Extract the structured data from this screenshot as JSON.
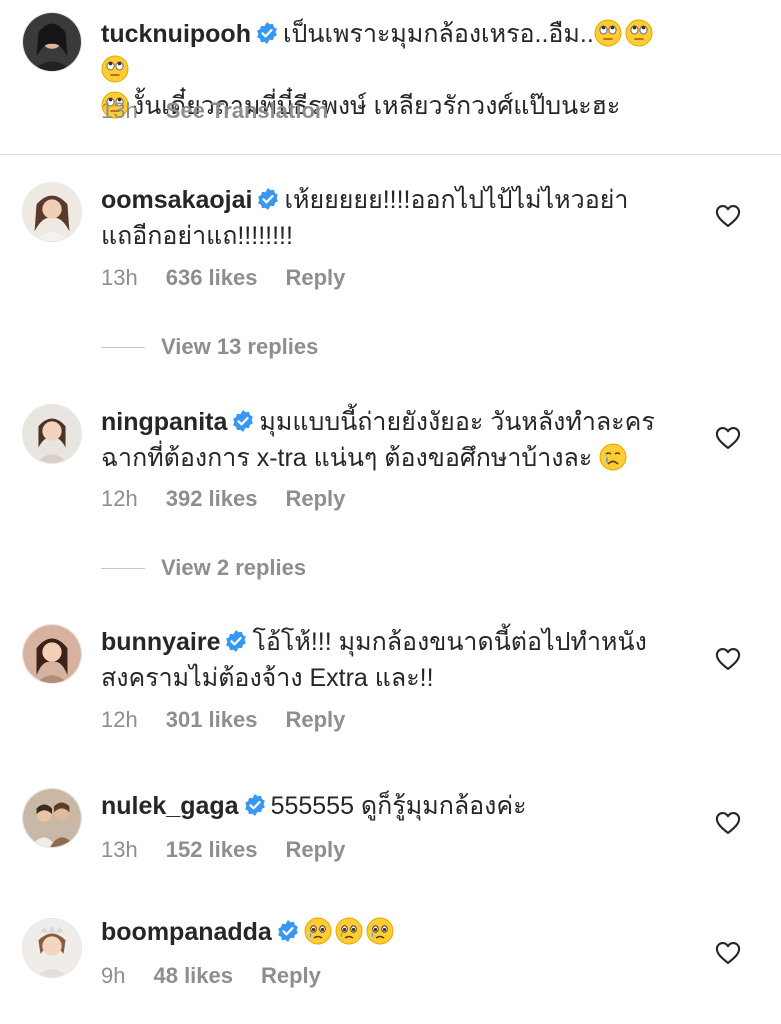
{
  "comments": [
    {
      "username": "tucknuipooh",
      "text_line1": "เป็นเพราะมุมกล้องเหรอ..อืม..",
      "text_line2": "งั้นเดี๋ยวถามพี่บี๋ธีรพงษ์ เหลียวรักวงศ์แป๊บนะฮะ",
      "emojis": [
        "face-with-rolling-eyes",
        "face-with-rolling-eyes",
        "face-with-rolling-eyes",
        "face-with-rolling-eyes"
      ],
      "time": "13h",
      "action": "See Translation"
    },
    {
      "username": "oomsakaojai",
      "text_line1": "เห้ยยยยย!!!!ออกไปไป้ไม่ไหวอย่า",
      "text_line2": "แถอีกอย่าแถ!!!!!!!!",
      "time": "13h",
      "likes": "636 likes",
      "reply": "Reply",
      "view_replies": "View 13 replies"
    },
    {
      "username": "ningpanita",
      "text_line1": "มุมแบบนี้ถ่ายยังงัยอะ วันหลังทำละคร",
      "text_line2": "ฉากที่ต้องการ x-tra แน่นๆ ต้องขอศึกษาบ้างละ",
      "emojis": [
        "crying-face"
      ],
      "time": "12h",
      "likes": "392 likes",
      "reply": "Reply",
      "view_replies": "View 2 replies"
    },
    {
      "username": "bunnyaire",
      "text_line1": "โอ้โห้!!! มุมกล้องขนาดนี้ต่อไปทำหนัง",
      "text_line2": "สงครามไม่ต้องจ้าง Extra และ!!",
      "time": "12h",
      "likes": "301 likes",
      "reply": "Reply"
    },
    {
      "username": "nulek_gaga",
      "text_line1": "555555 ดูก็รู้มุมกล้องค่ะ",
      "time": "13h",
      "likes": "152 likes",
      "reply": "Reply"
    },
    {
      "username": "boompanadda",
      "emojis": [
        "face-holding-back-tears",
        "face-holding-back-tears",
        "face-holding-back-tears"
      ],
      "time": "9h",
      "likes": "48 likes",
      "reply": "Reply"
    }
  ],
  "colors": {
    "text": "#262626",
    "meta": "#8e8e8e",
    "verified": "#3897f0",
    "divider": "#dbdbdb"
  }
}
